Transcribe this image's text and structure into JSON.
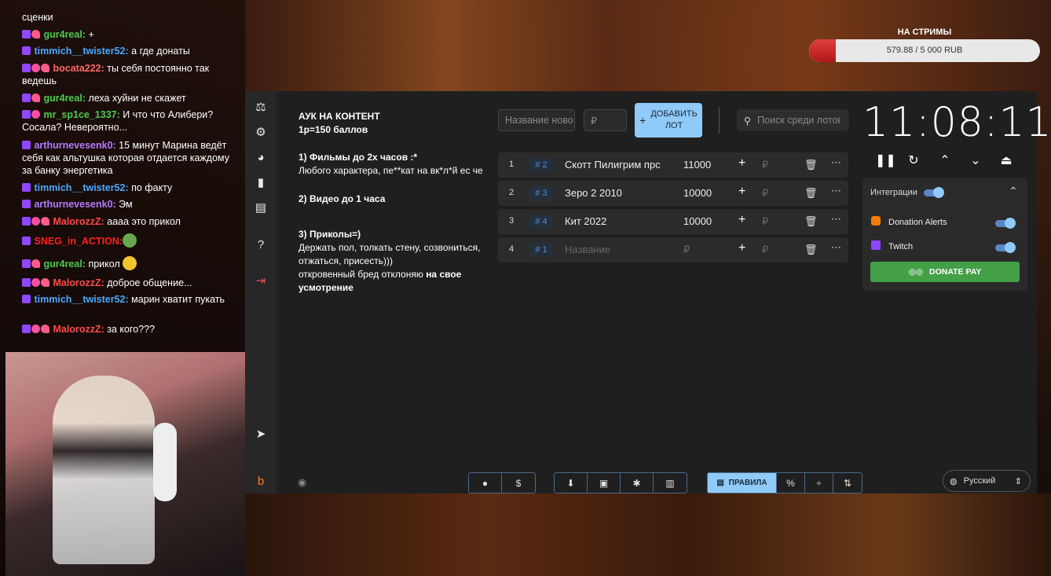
{
  "donation_goal": {
    "label": "НА СТРИМЫ",
    "text": "579.88 / 5 000 RUB",
    "progress_fraction": 0.116
  },
  "chat": [
    {
      "user": "",
      "text": "сценки",
      "color": "#ffffff"
    },
    {
      "user": "gur4real:",
      "text": " +",
      "color": "#4ec94e"
    },
    {
      "user": "timmich__twister52:",
      "text": " а где донаты",
      "color": "#4aa8ff"
    },
    {
      "user": "bocata222:",
      "text": " ты себя постоянно так ведешь",
      "color": "#ff6a6a"
    },
    {
      "user": "gur4real:",
      "text": " леха хуйни не скажет",
      "color": "#4ec94e"
    },
    {
      "user": "mr_sp1ce_1337:",
      "text": " И что что Алибери? Сосала? Невероятно...",
      "color": "#4ec94e"
    },
    {
      "user": "arthurnevesenk0:",
      "text": " 15 минут Марина ведёт себя как альтушка которая отдается каждому за банку энергетика",
      "color": "#b57aff"
    },
    {
      "user": "timmich__twister52:",
      "text": " по факту",
      "color": "#4aa8ff"
    },
    {
      "user": "arthurnevesenk0:",
      "text": " Эм",
      "color": "#b57aff"
    },
    {
      "user": "MalorozzZ:",
      "text": " аааа это прикол",
      "color": "#ff4a4a"
    },
    {
      "user": "SNEG_in_ACTION:",
      "text": "",
      "color": "#ff2020"
    },
    {
      "user": "gur4real:",
      "text": " прикол",
      "color": "#4ec94e"
    },
    {
      "user": "MalorozzZ:",
      "text": " доброе общение...",
      "color": "#ff4a4a"
    },
    {
      "user": "timmich__twister52:",
      "text": " марин хватит пукать",
      "color": "#4aa8ff"
    },
    {
      "user": "MalorozzZ:",
      "text": " за кого???",
      "color": "#ff4a4a"
    }
  ],
  "rules": {
    "title": "АУК НА КОНТЕНТ",
    "subtitle": "1р=150 баллов",
    "item1_title": "1) Фильмы до 2х часов :*",
    "item1_text": "Любого характера, пе**кат на вк*л*й ес че",
    "item2_title": "2) Видео до 1 часа",
    "item3_title": "3) Приколы=)",
    "item3_text": "Держать пол, толкать стену, созвониться, отжаться, присесть)))",
    "item3_text2": "откровенный бред отклоняю ",
    "item3_bold": "на свое усмотрение"
  },
  "new_lot": {
    "name_placeholder": "Название нового",
    "amount_placeholder": "₽",
    "add_label_1": "ДОБАВИТЬ",
    "add_label_2": "ЛОТ"
  },
  "search": {
    "placeholder": "Поиск среди лотов"
  },
  "lots": [
    {
      "num": "1",
      "tag": "# 2",
      "name": "Скотт Пилигрим прс",
      "amount": "11000"
    },
    {
      "num": "2",
      "tag": "# 3",
      "name": "Зеро 2 2010",
      "amount": "10000"
    },
    {
      "num": "3",
      "tag": "# 4",
      "name": "Кит 2022",
      "amount": "10000"
    },
    {
      "num": "4",
      "tag": "# 1",
      "name": "Название",
      "amount": "₽"
    }
  ],
  "rub_sign": "₽",
  "timer": "11:08:11",
  "integrations": {
    "title": "Интеграции",
    "items": [
      {
        "name": "Donation Alerts"
      },
      {
        "name": "Twitch"
      }
    ],
    "donate_pay": "DONATE PAY"
  },
  "toolbar": {
    "rules_label": "ПРАВИЛА"
  },
  "language": {
    "selected": "Русский"
  }
}
